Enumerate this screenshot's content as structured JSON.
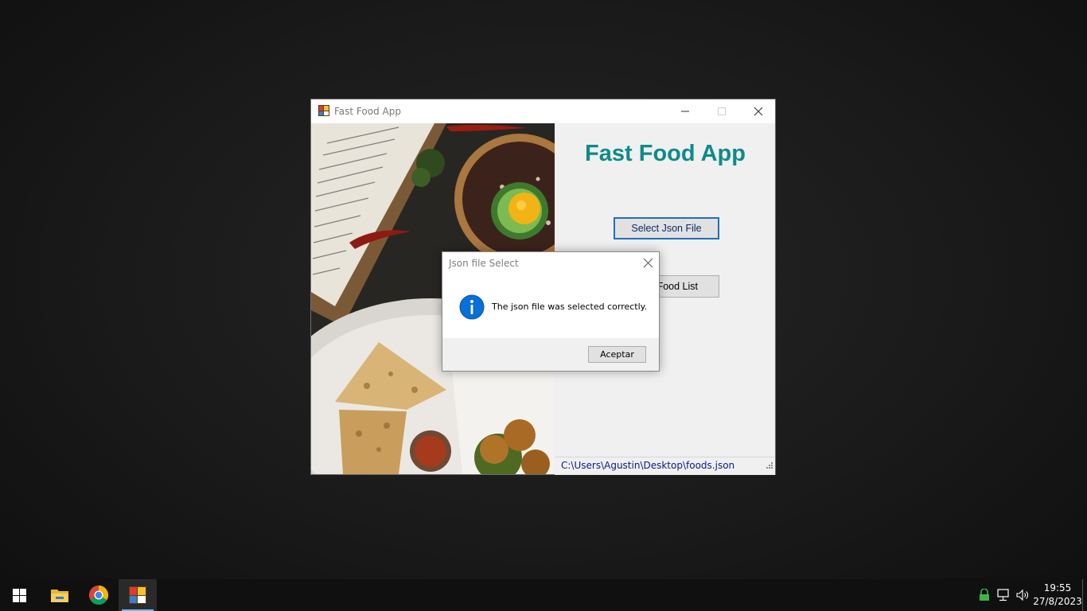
{
  "window": {
    "title": "Fast Food App",
    "header": "Fast Food App",
    "buttons": {
      "select_json": "Select Json File",
      "food_list": "Food List"
    },
    "status_path": "C:\\Users\\Agustin\\Desktop\\foods.json"
  },
  "dialog": {
    "title": "Json file Select",
    "message": "The json file was selected correctly.",
    "ok_label": "Aceptar",
    "icon": "info-icon"
  },
  "taskbar": {
    "apps": [
      "start-icon",
      "file-explorer-icon",
      "chrome-icon",
      "fast-food-app-icon"
    ],
    "tray": [
      "security-icon",
      "network-icon",
      "volume-icon"
    ],
    "time": "19:55",
    "date": "27/8/2023"
  },
  "colors": {
    "header_text": "#0f8a8a",
    "status_text": "#0a1a8a",
    "focus_border": "#1f6fbf",
    "info_icon": "#0a6fd6"
  }
}
